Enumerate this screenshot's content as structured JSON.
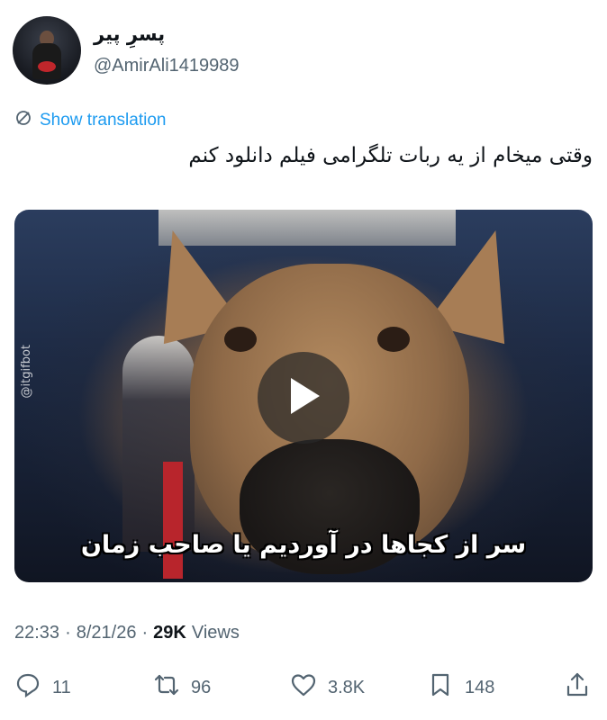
{
  "author": {
    "display_name": "پسرِ پیر",
    "handle": "@AmirAli1419989"
  },
  "translate_label": "Show translation",
  "tweet_text": "وقتی میخام از یه ربات تلگرامی فیلم دانلود کنم",
  "media": {
    "watermark": "@itgifbot",
    "caption": "سر از کجاها در آوردیم یا صاحب زمان"
  },
  "meta": {
    "time": "22:33",
    "separator": "·",
    "date": "8/21/26",
    "separator2": "·",
    "views_count": "29K",
    "views_label": "Views"
  },
  "actions": {
    "replies": "11",
    "reposts": "96",
    "likes": "3.8K",
    "bookmarks": "148"
  },
  "colors": {
    "accent": "#1d9bf0",
    "secondary_text": "#536471",
    "primary_text": "#0f1419"
  },
  "icons": {
    "translate": "globe-slash-icon",
    "play": "play-icon",
    "reply": "reply-icon",
    "repost": "repost-icon",
    "like": "heart-icon",
    "bookmark": "bookmark-icon",
    "share": "share-icon"
  }
}
